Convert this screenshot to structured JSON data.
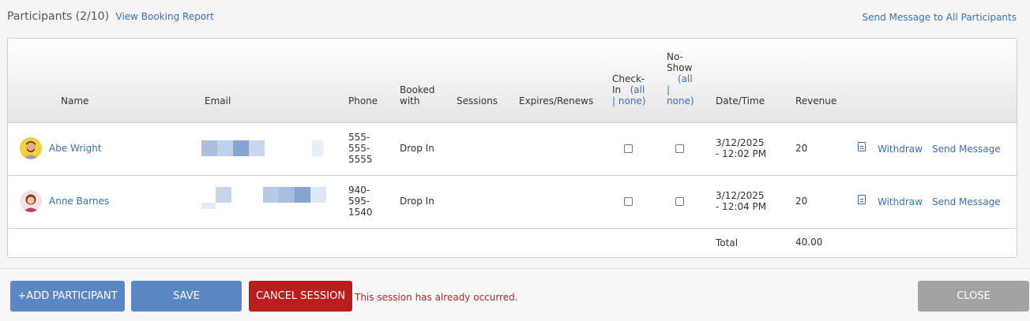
{
  "header": {
    "title": "Participants (2/10)",
    "view_report": "View Booking Report",
    "send_all": "Send Message to All Participants"
  },
  "table": {
    "columns": {
      "name": "Name",
      "email": "Email",
      "phone": "Phone",
      "booked_with_1": "Booked",
      "booked_with_2": "with",
      "sessions": "Sessions",
      "expires": "Expires/Renews",
      "checkin_1": "Check-",
      "checkin_2": "In",
      "noshow_1": "No-",
      "noshow_2": "Show",
      "all": "(all",
      "pipe": "|",
      "none": "none)",
      "datetime": "Date/Time",
      "revenue": "Revenue"
    },
    "rows": [
      {
        "name": "Abe Wright",
        "phone_1": "555-",
        "phone_2": "555-",
        "phone_3": "5555",
        "booked_with": "Drop In",
        "sessions": "",
        "expires": "",
        "checked_in": false,
        "no_show": false,
        "date_1": "3/12/2025",
        "date_2": "- 12:02 PM",
        "revenue": "20",
        "withdraw": "Withdraw",
        "send_message": "Send Message"
      },
      {
        "name": "Anne Barnes",
        "phone_1": "940-",
        "phone_2": "595-",
        "phone_3": "1540",
        "booked_with": "Drop In",
        "sessions": "",
        "expires": "",
        "checked_in": false,
        "no_show": false,
        "date_1": "3/12/2025",
        "date_2": "- 12:04 PM",
        "revenue": "20",
        "withdraw": "Withdraw",
        "send_message": "Send Message"
      }
    ],
    "total_label": "Total",
    "total_value": "40.00"
  },
  "footer": {
    "add_participant": "+ADD PARTICIPANT",
    "save": "SAVE",
    "cancel_session": "CANCEL SESSION",
    "warning": "This session has already occurred.",
    "close": "CLOSE"
  },
  "colors": {
    "link": "#3b6fb5",
    "primary_button": "#5a86c4",
    "danger_button": "#b91d1d",
    "close_button": "#a3a3a3",
    "warning_text": "#b02a2a"
  },
  "icons": {
    "report": "document-icon",
    "avatars": [
      "avatar-male",
      "avatar-female"
    ]
  }
}
